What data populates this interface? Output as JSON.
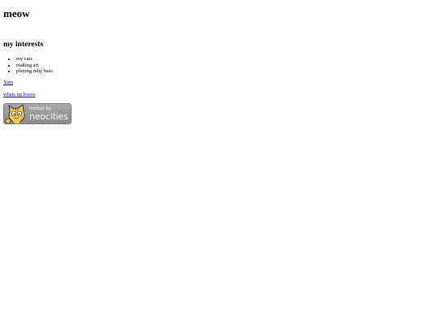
{
  "page": {
    "title": "meow",
    "interests_heading": "my interests",
    "interests": [
      "my cats",
      "making art",
      "playing mhy bass"
    ],
    "links": [
      {
        "label": "Yarn"
      },
      {
        "label": "whats up losers"
      }
    ],
    "badge": {
      "hosted_text": "hosted by",
      "brand_text": "neocities",
      "icon": "neocities-cat-icon"
    }
  },
  "colors": {
    "link": "#0000ee",
    "badge_bg": "#9a9a9a"
  }
}
